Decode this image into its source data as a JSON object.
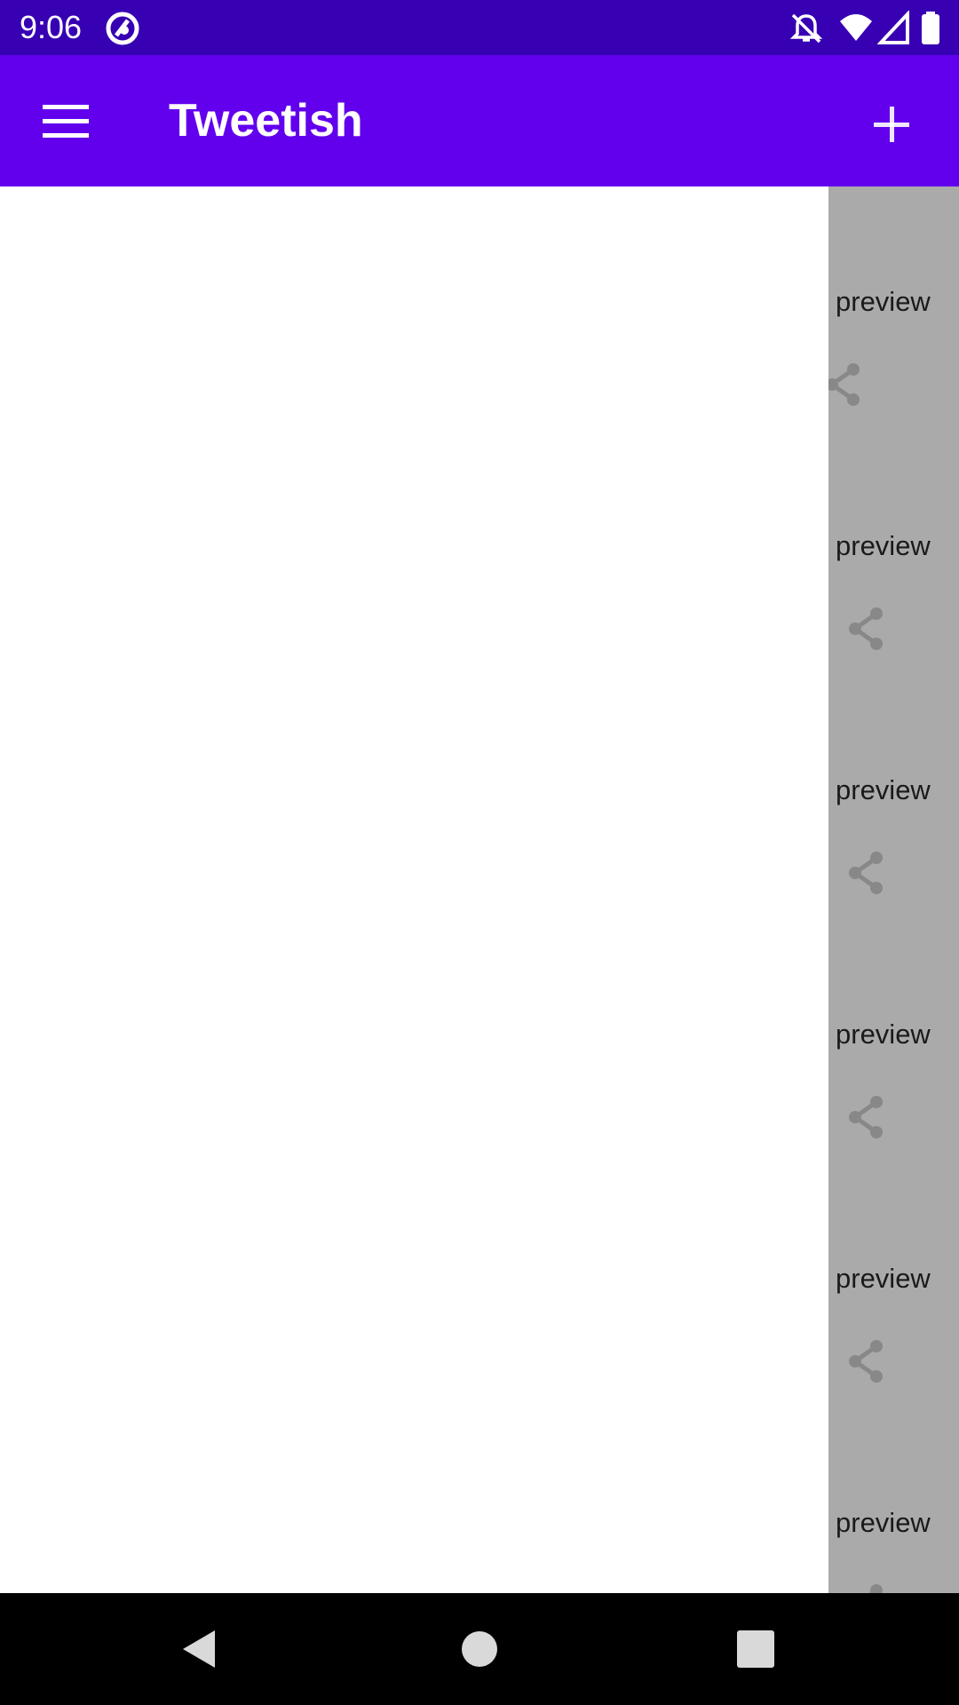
{
  "status_bar": {
    "time": "9:06",
    "icons": [
      "app-notification-icon",
      "notifications-off-icon",
      "wifi-icon",
      "cell-signal-icon",
      "battery-icon"
    ],
    "background": "#3700B3"
  },
  "app_bar": {
    "title": "Tweetish",
    "menu_icon": "menu-icon",
    "add_icon": "add-icon",
    "background": "#6200EE"
  },
  "drawer_scrim": {
    "background": "#aaaaaa",
    "items": [
      {
        "label": "preview",
        "icon": "share-icon"
      },
      {
        "label": "preview",
        "icon": "share-icon"
      },
      {
        "label": "preview",
        "icon": "share-icon"
      },
      {
        "label": "preview",
        "icon": "share-icon"
      },
      {
        "label": "preview",
        "icon": "share-icon"
      },
      {
        "label": "preview",
        "icon": "share-icon"
      }
    ]
  },
  "nav_bar": {
    "buttons": [
      "back-icon",
      "home-icon",
      "recents-icon"
    ]
  }
}
